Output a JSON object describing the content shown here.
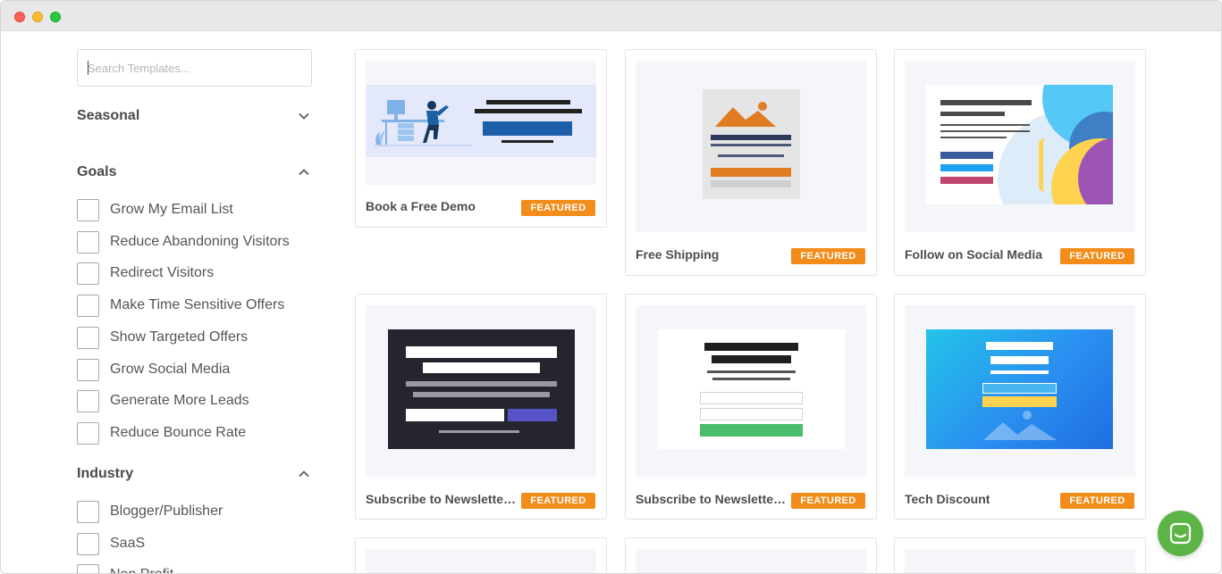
{
  "window": {
    "controls": [
      "close",
      "minimize",
      "zoom"
    ]
  },
  "sidebar": {
    "search": {
      "placeholder": "Search Templates...",
      "value": ""
    },
    "sections": {
      "seasonal": {
        "title": "Seasonal",
        "state": "collapsed"
      },
      "goals": {
        "title": "Goals",
        "state": "expanded",
        "items": [
          {
            "label": "Grow My Email List",
            "checked": false
          },
          {
            "label": "Reduce Abandoning Visitors",
            "checked": false
          },
          {
            "label": "Redirect Visitors",
            "checked": false
          },
          {
            "label": "Make Time Sensitive Offers",
            "checked": false
          },
          {
            "label": "Show Targeted Offers",
            "checked": false
          },
          {
            "label": "Grow Social Media",
            "checked": false
          },
          {
            "label": "Generate More Leads",
            "checked": false
          },
          {
            "label": "Reduce Bounce Rate",
            "checked": false
          }
        ]
      },
      "industry": {
        "title": "Industry",
        "state": "expanded",
        "items": [
          {
            "label": "Blogger/Publisher",
            "checked": false
          },
          {
            "label": "SaaS",
            "checked": false
          },
          {
            "label": "Non Profit",
            "checked": false
          }
        ]
      }
    }
  },
  "templates": [
    {
      "title": "Book a Free Demo",
      "badge": "FEATURED"
    },
    {
      "title": "Free Shipping",
      "badge": "FEATURED"
    },
    {
      "title": "Follow on Social Media",
      "badge": "FEATURED"
    },
    {
      "title": "Subscribe to Newsletter ...",
      "badge": "FEATURED"
    },
    {
      "title": "Subscribe to Newsletter ...",
      "badge": "FEATURED"
    },
    {
      "title": "Tech Discount",
      "badge": "FEATURED"
    }
  ],
  "colors": {
    "badge": "#f28c1a",
    "chat_button": "#5cb446",
    "thumbnail_bg": "#f5f6fa"
  },
  "icons": {
    "seasonal_toggle": "chevron-down-icon",
    "goals_toggle": "chevron-up-icon",
    "industry_toggle": "chevron-up-icon",
    "chat": "chat-icon"
  }
}
